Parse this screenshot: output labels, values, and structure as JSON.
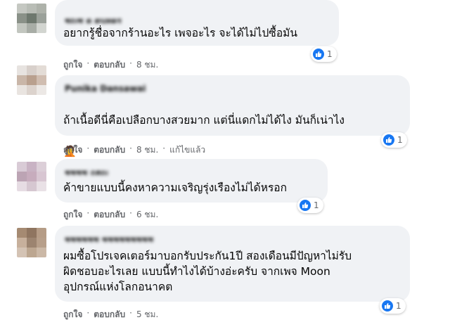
{
  "like_label": "ถูกใจ",
  "reply_label": "ตอบกลับ",
  "dot": "·",
  "comments": [
    {
      "name": "ชญช ด ตนทดร",
      "text": "อยากรู้ชื่อจากร้านอะไร เพจอะไร จะได้ไม่ไปซื้อมัน",
      "time": "8 ชม.",
      "edited": "",
      "likes": "1",
      "avatar_colors": [
        "#c5c8c2",
        "#b9bdb6",
        "#aeb2aa",
        "#8a9188",
        "#6e786e",
        "#9ba19a",
        "#c2c6bf",
        "#a8ada6",
        "#d2d5d0"
      ]
    },
    {
      "name": "Punika Dansawai",
      "text": "ถ้าเนื้อดีนี่คือเปลือกบางสวยมาก แต่นี่แดกไม่ได้ไง มันก็เน่าไง",
      "emoji": "🤦",
      "time": "8 ชม.",
      "edited": "แก้ไขแล้ว",
      "likes": "1",
      "avatar_colors": [
        "#e7e3e0",
        "#d8d0cb",
        "#e3dcd6",
        "#c9b6a8",
        "#b9a08e",
        "#d0bdb0",
        "#e9e4e0",
        "#dcd3cd",
        "#ece8e5"
      ]
    },
    {
      "name": "ชชชช ฤฮญ",
      "text": "ค้าขายแบบนี้คงหาความเจริญรุ่งเรืองไม่ได้หรอก",
      "time": "6 ชม.",
      "edited": "",
      "likes": "1",
      "avatar_colors": [
        "#d9cbd6",
        "#c9b3c4",
        "#dccfd8",
        "#bca4b4",
        "#c7acbd",
        "#d8c6d2",
        "#e6dce3",
        "#d6c7d1",
        "#e9e1e6"
      ]
    },
    {
      "name": "ชชชชชช ชชชชชชชชช",
      "text": "ผมซื้อโปรเจคเตอร์มาบอกรับประกัน1ปี สองเดือนมีปัญหาไม่รับ\nผิดชอบอะไรเลย แบบนี้ทำไงได้บ้างอ่ะครับ จากเพจ Moon\nอุปกรณ์แห่งโลกอนาคต",
      "time": "5 ชม.",
      "edited": "",
      "likes": "1",
      "avatar_colors": [
        "#a58a72",
        "#8f7560",
        "#b59c86",
        "#c7b09c",
        "#9c8470",
        "#b79f8a",
        "#d4c3b4",
        "#bca690",
        "#cbb8a6"
      ]
    }
  ]
}
